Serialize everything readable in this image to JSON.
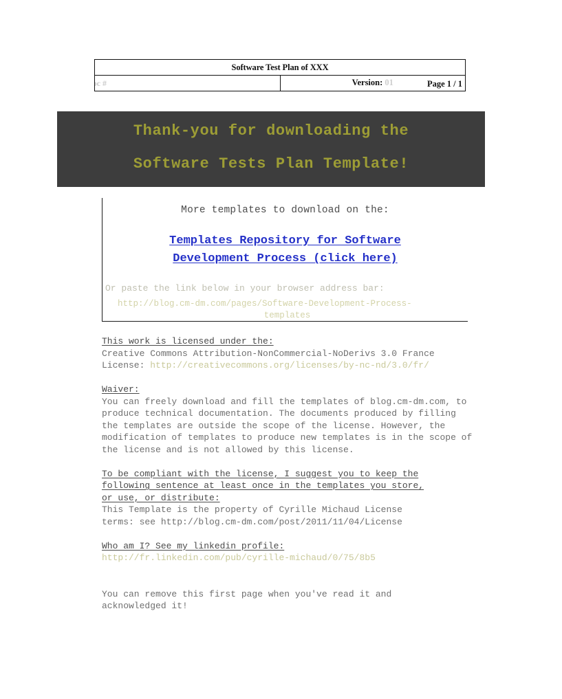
{
  "document": {
    "header": {
      "title": "Software Test Plan of XXX",
      "doc_number_label": "Doc #",
      "version_label": "Version:",
      "version_value": "01",
      "page_label": "Page 1 / 1"
    },
    "banner": {
      "line1": "Thank-you for downloading the",
      "line2": "Software Tests Plan Template!",
      "background_color": "#3d3d3d",
      "text_color": "#9d9d35"
    },
    "repository": {
      "intro": "More templates to download on the:",
      "link_line1": "Templates Repository for Software",
      "link_line2": "Development Process (click here)",
      "link_color": "#2430c8",
      "paste_instruction": "Or paste the link below in your browser address bar:",
      "url_line1": "http://blog.cm-dm.com/pages/Software-Development-Process-",
      "url_line2": "templates",
      "url_color": "#d3d3a8"
    },
    "license": {
      "heading": "This work is licensed under the:",
      "line1": "Creative Commons Attribution-NonCommercial-NoDerivs 3.0 France",
      "line2_prefix": "License: ",
      "line2_url": "http://creativecommons.org/licenses/by-nc-nd/3.0/fr/"
    },
    "waiver": {
      "heading": "Waiver:",
      "body": "You can freely download and fill the templates of blog.cm-dm.com, to produce technical documentation. The documents produced by filling the templates are outside the scope of the license. However, the modification of templates to produce new templates is in the scope of the license and is not allowed by this license."
    },
    "compliance": {
      "heading_line1": "To be compliant with the license, I suggest you to keep the",
      "heading_line2": "following sentence at least once in the templates you store,",
      "heading_line3": "or use, or distribute:",
      "body_line1": "This Template is the property of Cyrille Michaud License",
      "body_line2": "terms: see http://blog.cm-dm.com/post/2011/11/04/License"
    },
    "author": {
      "heading": "Who am I? See my linkedin profile:",
      "url": "http://fr.linkedin.com/pub/cyrille-michaud/0/75/8b5"
    },
    "footer_note": {
      "line1": "You can remove this first page when you've read it and",
      "line2": "acknowledged it!"
    }
  }
}
